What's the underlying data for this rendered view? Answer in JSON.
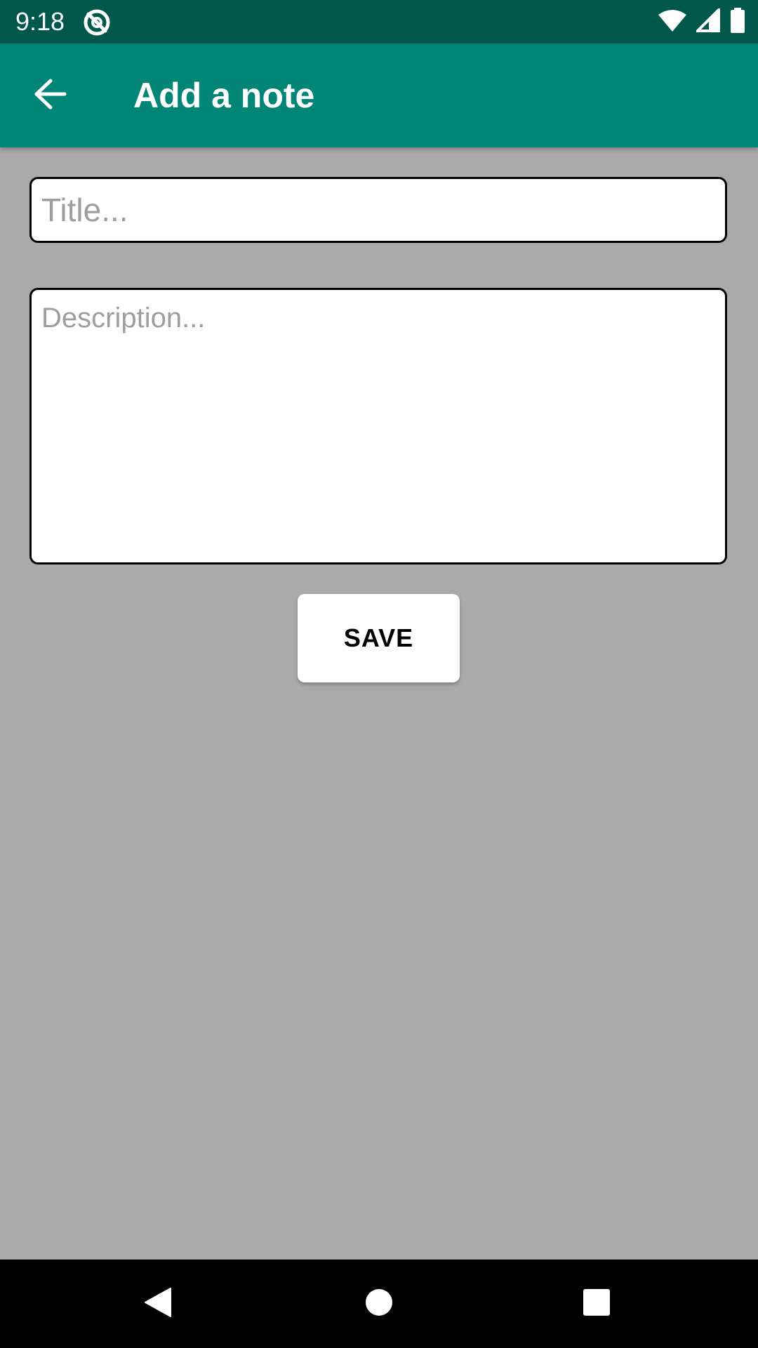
{
  "status_bar": {
    "time": "9:18",
    "icons": [
      "app-notification-icon",
      "wifi-icon",
      "cell-signal-icon",
      "battery-icon"
    ]
  },
  "app_bar": {
    "title": "Add a note",
    "back_icon": "arrow-back-icon",
    "background_color": "#008577"
  },
  "form": {
    "title_placeholder": "Title...",
    "title_value": "",
    "description_placeholder": "Description...",
    "description_value": "",
    "save_label": "SAVE"
  },
  "nav_bar": {
    "icons": [
      "back-triangle-icon",
      "home-circle-icon",
      "recents-square-icon"
    ]
  },
  "colors": {
    "status_bar": "#00574c",
    "app_bar": "#008577",
    "background": "#aaaaaa"
  }
}
